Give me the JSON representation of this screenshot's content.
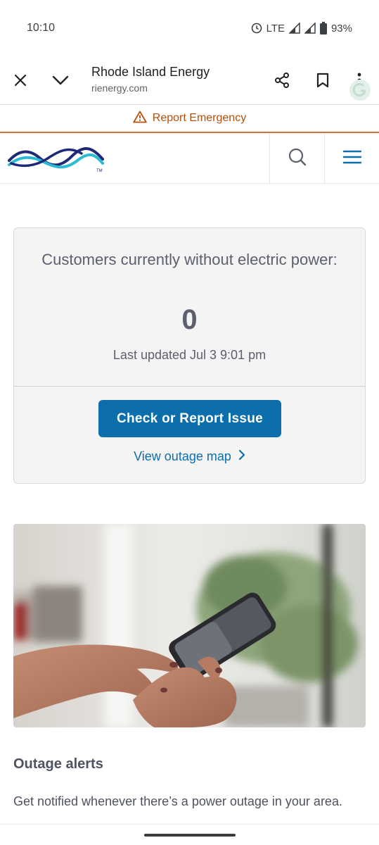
{
  "status_bar": {
    "time": "10:10",
    "network": "LTE",
    "battery": "93%",
    "icons": [
      "alarm-icon",
      "signal-icon",
      "signal-icon",
      "battery-icon"
    ]
  },
  "browser": {
    "site_name": "Rhode Island Energy",
    "url": "rienergy.com",
    "icons": [
      "close-icon",
      "chevron-down-icon",
      "share-icon",
      "bookmark-icon",
      "more-vert-icon"
    ]
  },
  "emergency": {
    "label": "Report Emergency",
    "icon": "warning-icon",
    "color": "#b54f09"
  },
  "site_header": {
    "icons": [
      "logo",
      "search-icon",
      "menu-icon"
    ],
    "accent": "#0c6eaa"
  },
  "outage_card": {
    "heading": "Customers currently without electric power:",
    "count": "0",
    "updated": "Last updated Jul 3 9:01 pm",
    "button_label": "Check or Report Issue",
    "link_label": "View outage map"
  },
  "alerts": {
    "title": "Outage alerts",
    "text": "Get notified whenever there’s a power outage in your area."
  }
}
